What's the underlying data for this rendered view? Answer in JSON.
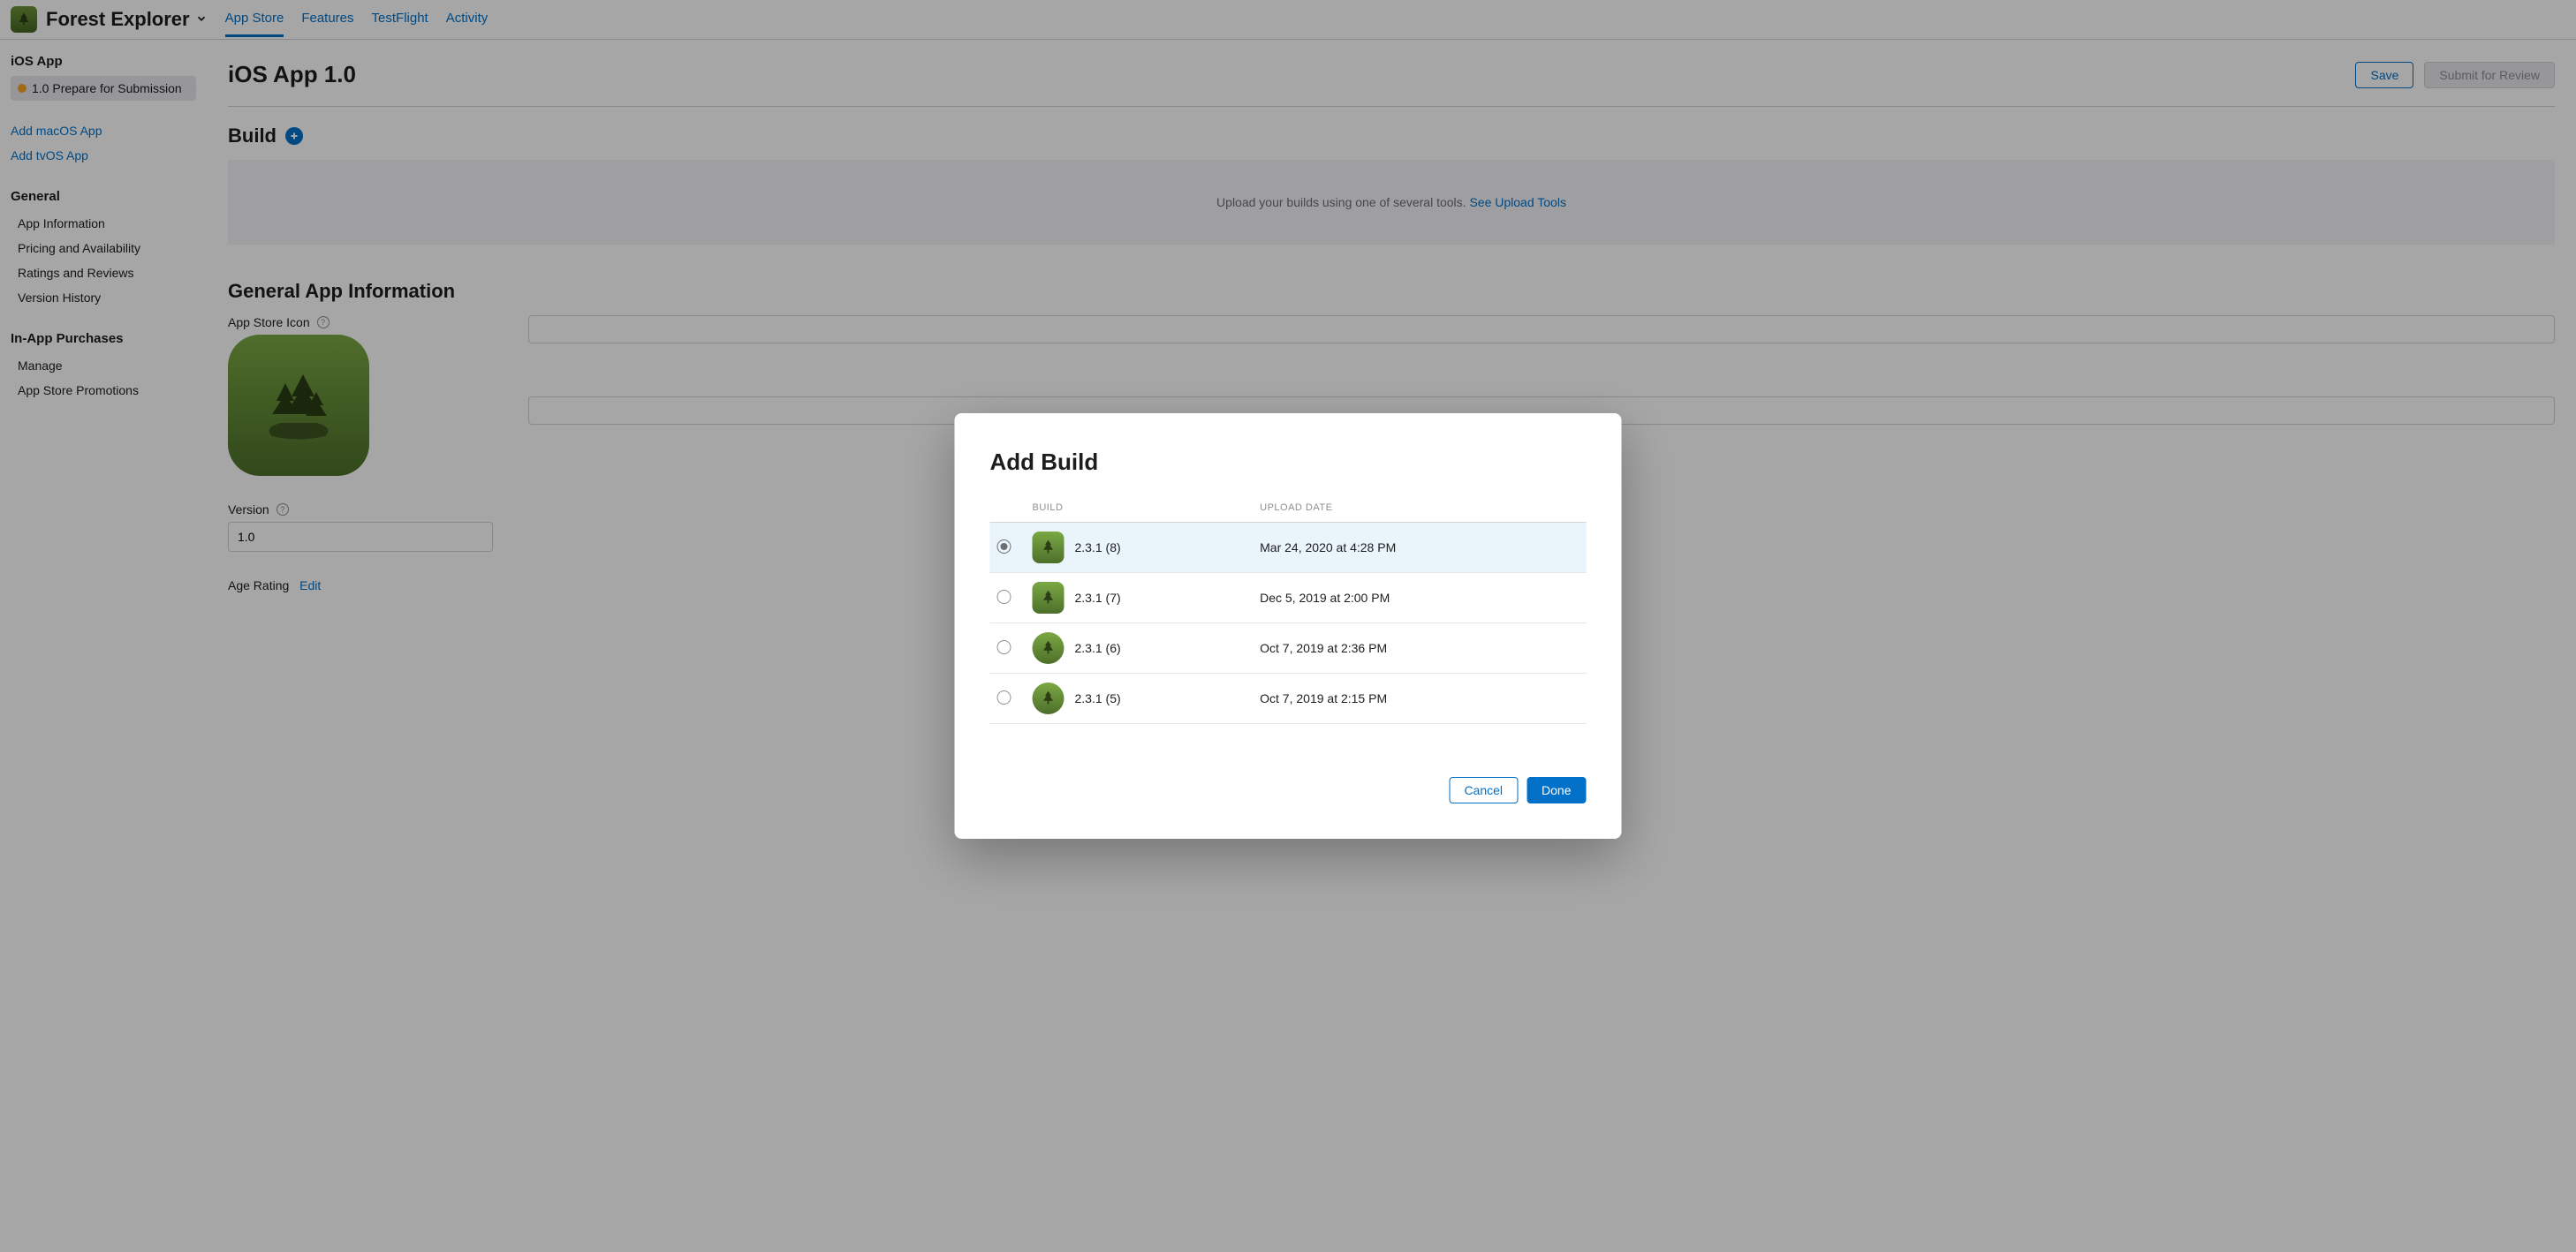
{
  "header": {
    "appName": "Forest Explorer",
    "tabs": [
      "App Store",
      "Features",
      "TestFlight",
      "Activity"
    ]
  },
  "sidebar": {
    "sectionTitle1": "iOS App",
    "versionItem": "1.0 Prepare for Submission",
    "addMacOS": "Add macOS App",
    "addTvOS": "Add tvOS App",
    "general": {
      "title": "General",
      "items": [
        "App Information",
        "Pricing and Availability",
        "Ratings and Reviews",
        "Version History"
      ]
    },
    "inAppPurchases": {
      "title": "In-App Purchases",
      "items": [
        "Manage",
        "App Store Promotions"
      ]
    }
  },
  "page": {
    "title": "iOS App 1.0",
    "saveLabel": "Save",
    "submitLabel": "Submit for Review",
    "buildTitle": "Build",
    "uploadText": "Upload your builds using one of several tools.",
    "uploadLink": "See Upload Tools",
    "generalAppInfoTitle": "General App Information",
    "appStoreIconLabel": "App Store Icon",
    "versionLabel": "Version",
    "versionValue": "1.0",
    "ageRatingLabel": "Age Rating",
    "editLabel": "Edit"
  },
  "modal": {
    "title": "Add Build",
    "columns": {
      "build": "BUILD",
      "uploadDate": "UPLOAD DATE"
    },
    "rows": [
      {
        "version": "2.3.1 (8)",
        "date": "Mar 24, 2020 at 4:28 PM",
        "selected": true,
        "round": false
      },
      {
        "version": "2.3.1 (7)",
        "date": "Dec 5, 2019 at 2:00 PM",
        "selected": false,
        "round": false
      },
      {
        "version": "2.3.1 (6)",
        "date": "Oct 7, 2019 at 2:36 PM",
        "selected": false,
        "round": true
      },
      {
        "version": "2.3.1 (5)",
        "date": "Oct 7, 2019 at 2:15 PM",
        "selected": false,
        "round": true
      }
    ],
    "cancelLabel": "Cancel",
    "doneLabel": "Done"
  }
}
